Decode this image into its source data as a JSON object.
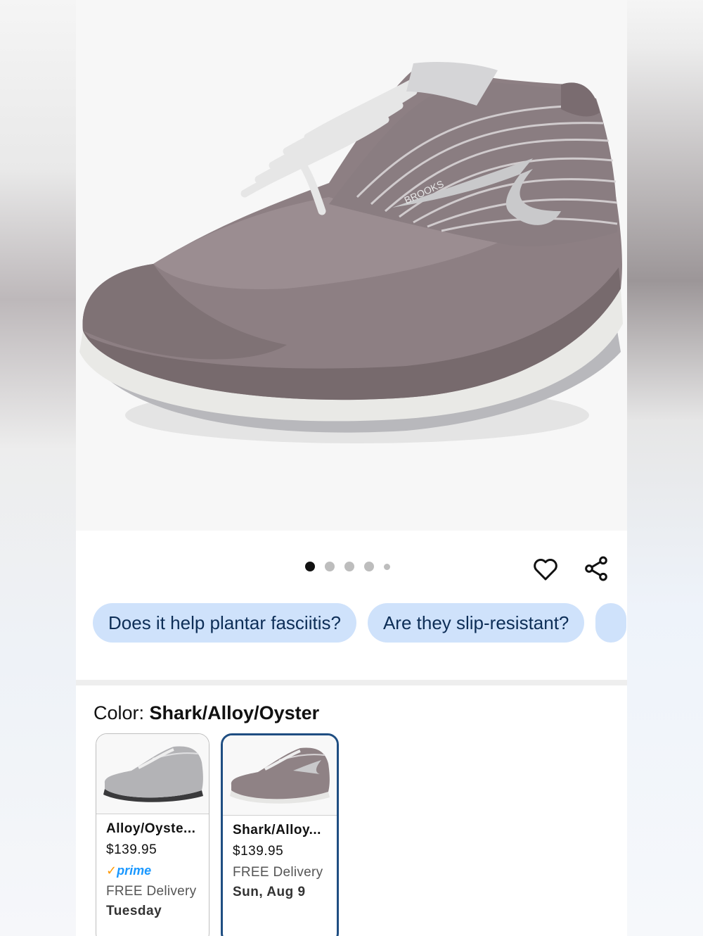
{
  "gallery": {
    "image_alt": "Brooks walking shoe",
    "brand_text": "BROOKS",
    "dot_count": 5,
    "active_index": 0
  },
  "actions": {
    "wishlist_icon": "heart-icon",
    "share_icon": "share-icon"
  },
  "questions": [
    {
      "label": "Does it help plantar fasciitis?"
    },
    {
      "label": "Are they slip-resistant?"
    }
  ],
  "color": {
    "label": "Color:",
    "selected_name": "Shark/Alloy/Oyster"
  },
  "variants": [
    {
      "name": "Alloy/Oyste...",
      "price": "$139.95",
      "prime": "prime",
      "delivery": "FREE Delivery",
      "day": "Tuesday",
      "shoe_color": "#b3b3b6"
    },
    {
      "name": "Shark/Alloy...",
      "price": "$139.95",
      "delivery": "FREE Delivery",
      "day": "Sun, Aug 9",
      "shoe_color": "#8f8285"
    }
  ],
  "colors": {
    "chip_bg": "#cfe2fb",
    "selected_border": "#1f4e82",
    "prime_blue": "#1a98ff",
    "prime_check": "#ff9900"
  }
}
